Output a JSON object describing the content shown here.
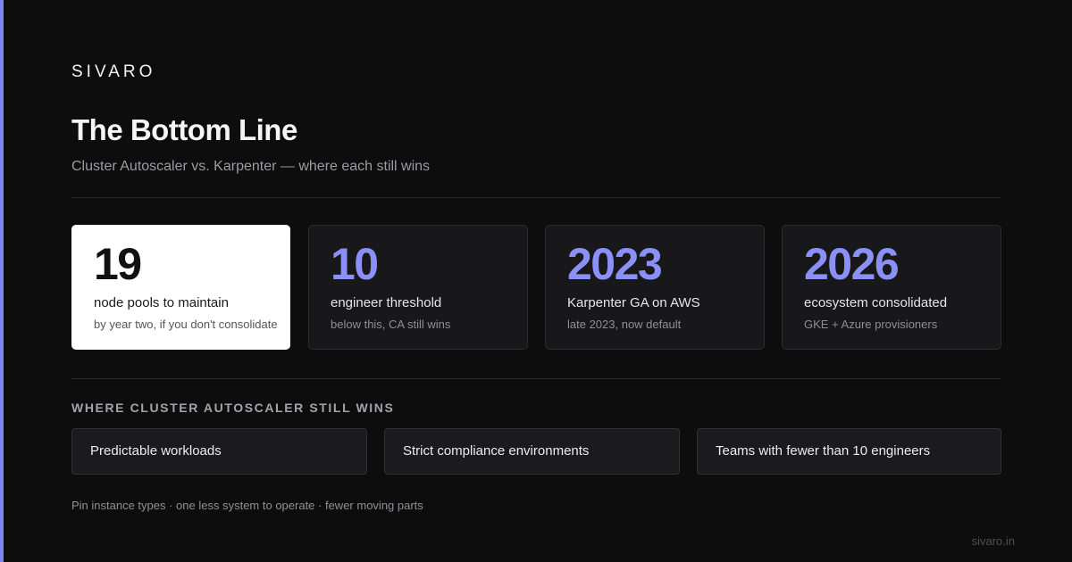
{
  "brand": "SIVARO",
  "title": "The Bottom Line",
  "subtitle": "Cluster Autoscaler vs. Karpenter — where each still wins",
  "colors": {
    "background": "#0d0d0e",
    "accent": "#7b85f0",
    "stat_value": "#8a90f5",
    "highlight_card": "#ffffff"
  },
  "stats": [
    {
      "value": "19",
      "label": "node pools to maintain",
      "note": "by year two, if you don't consolidate",
      "highlighted": true
    },
    {
      "value": "10",
      "label": "engineer threshold",
      "note": "below this, CA still wins",
      "highlighted": false
    },
    {
      "value": "2023",
      "label": "Karpenter GA on AWS",
      "note": "late 2023, now default",
      "highlighted": false
    },
    {
      "value": "2026",
      "label": "ecosystem consolidated",
      "note": "GKE + Azure provisioners",
      "highlighted": false
    }
  ],
  "wins_section": {
    "heading": "WHERE CLUSTER AUTOSCALER STILL WINS",
    "items": [
      "Predictable workloads",
      "Strict compliance environments",
      "Teams with fewer than 10 engineers"
    ]
  },
  "footnote": "Pin instance types · one less system to operate · fewer moving parts",
  "site": "sivaro.in"
}
